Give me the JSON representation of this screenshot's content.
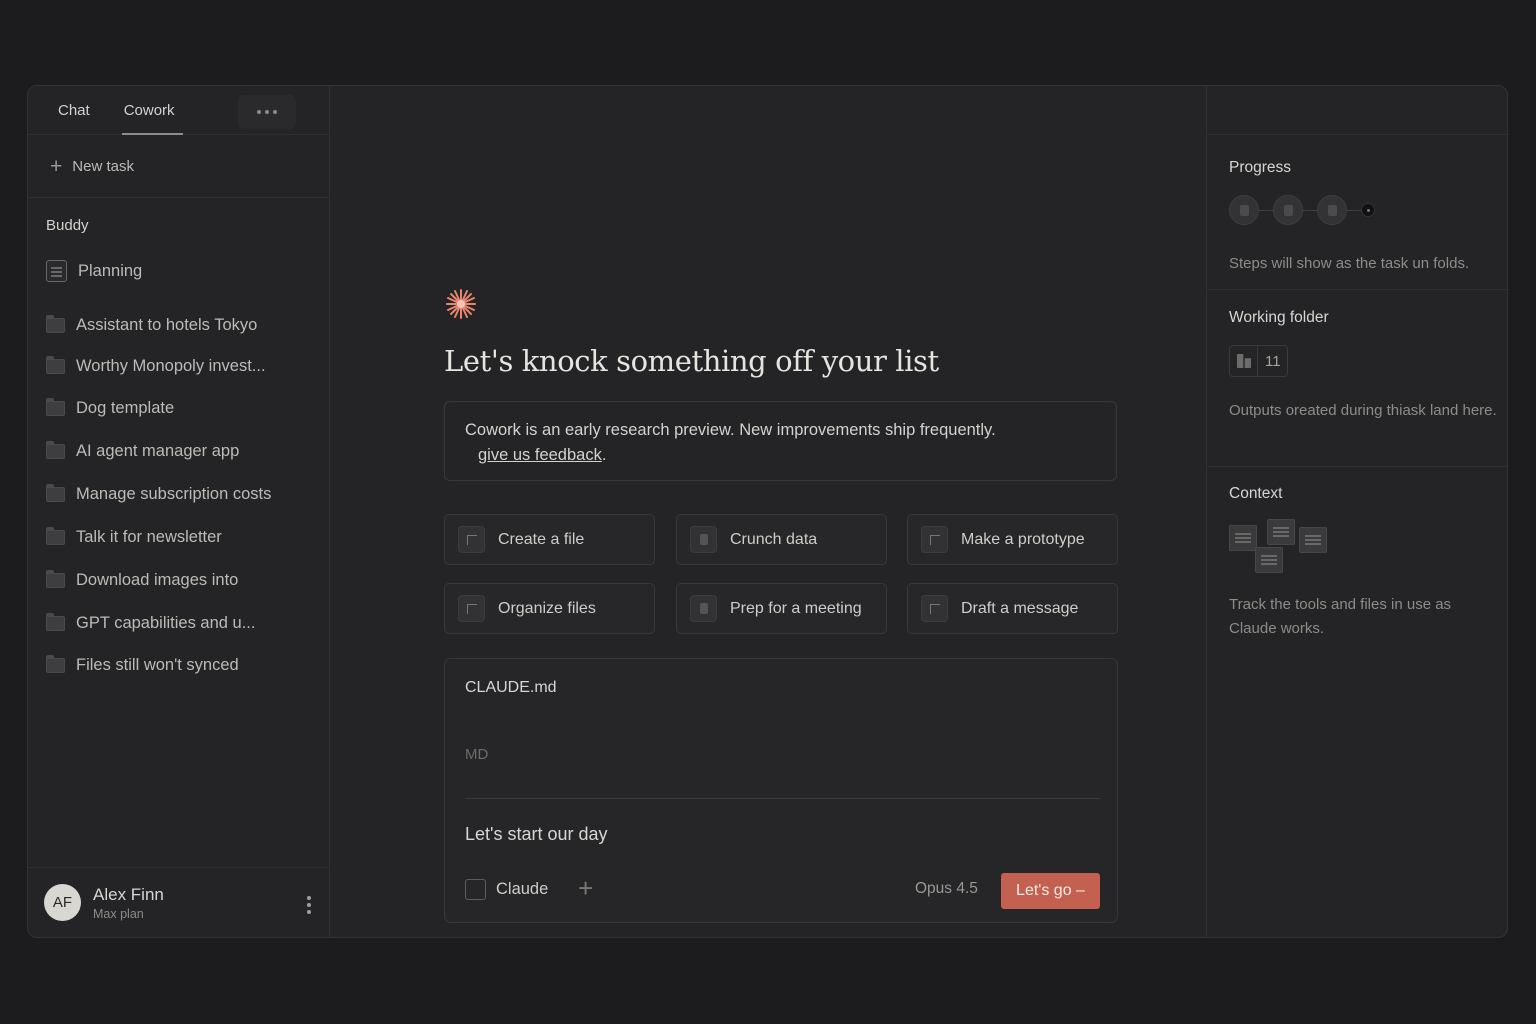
{
  "sidebar": {
    "tabs": [
      {
        "label": "Chat",
        "active": false
      },
      {
        "label": "Cowork",
        "active": true
      }
    ],
    "new_task_label": "New task",
    "section_label": "Buddy",
    "items": [
      {
        "label": "Planning",
        "icon": "document-icon"
      },
      {
        "label": "Assistant to hotels Tokyo",
        "icon": "folder-icon"
      },
      {
        "label": "Worthy Monopoly invest...",
        "icon": "folder-icon"
      },
      {
        "label": "Dog template",
        "icon": "folder-icon"
      },
      {
        "label": "AI agent manager app",
        "icon": "folder-icon"
      },
      {
        "label": "Manage subscription costs",
        "icon": "folder-icon"
      },
      {
        "label": "Talk it for newsletter",
        "icon": "folder-icon"
      },
      {
        "label": "Download images into",
        "icon": "folder-icon"
      },
      {
        "label": "GPT capabilities and u...",
        "icon": "folder-icon"
      },
      {
        "label": "Files still won't synced",
        "icon": "folder-icon"
      }
    ],
    "user": {
      "initials": "AF",
      "name": "Alex Finn",
      "plan": "Max plan"
    }
  },
  "main": {
    "headline": "Let's knock something off your list",
    "notice": {
      "text": "Cowork is an early research preview. New improvements ship frequently.",
      "link": "give us feedback",
      "link_suffix": "."
    },
    "suggestions": [
      {
        "label": "Create a file",
        "icon": "file-icon"
      },
      {
        "label": "Crunch data",
        "icon": "data-icon"
      },
      {
        "label": "Make a prototype",
        "icon": "prototype-icon"
      },
      {
        "label": "Organize files",
        "icon": "organize-icon"
      },
      {
        "label": "Prep for a meeting",
        "icon": "meeting-icon"
      },
      {
        "label": "Draft a message",
        "icon": "message-icon"
      }
    ],
    "composer": {
      "file_name": "CLAUDE.md",
      "file_type": "MD",
      "prompt": "Let's start our day",
      "tool_label": "Claude",
      "model": "Opus 4.5",
      "submit_label": "Let's go –"
    }
  },
  "right_panel": {
    "progress": {
      "title": "Progress",
      "description": "Steps will show as the task un folds."
    },
    "working_folder": {
      "title": "Working folder",
      "count": "11",
      "description": "Outputs oreated during thiask land here."
    },
    "context": {
      "title": "Context",
      "description": "Track the tools and files in use as Claude works."
    }
  },
  "colors": {
    "background": "#1c1c1e",
    "panel": "#242426",
    "accent": "#c4604f",
    "text": "#d8d6d2"
  }
}
